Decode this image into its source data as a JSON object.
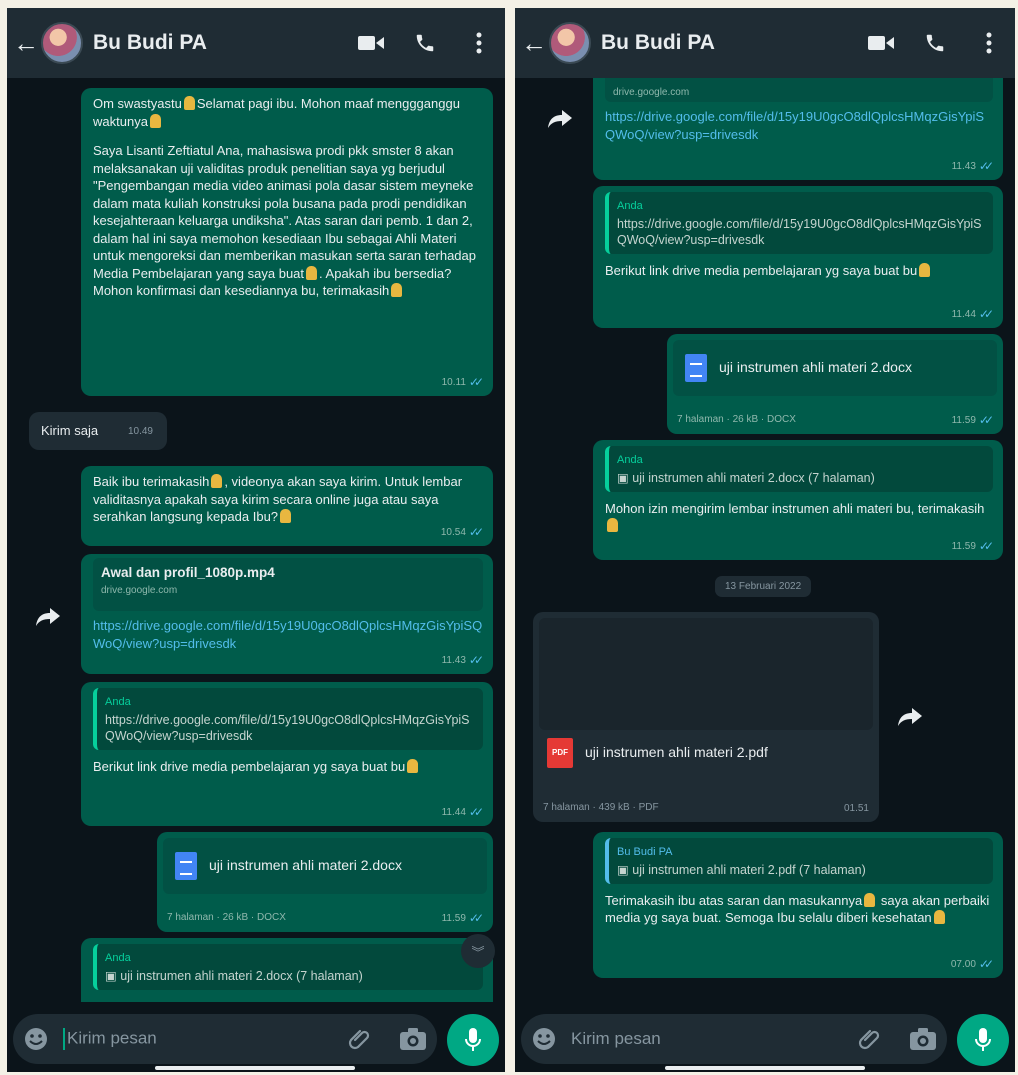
{
  "chat": {
    "contact_name": "Bu Budi PA",
    "input_placeholder": "Kirim pesan"
  },
  "left": {
    "m1": {
      "line1": "Om swastyastu",
      "line1b": "Selamat pagi ibu. Mohon maaf menggganggu waktunya",
      "body": "Saya Lisanti Zeftiatul Ana, mahasiswa prodi pkk smster 8 akan melaksanakan uji validitas produk penelitian saya yg berjudul \"Pengembangan media video animasi pola dasar sistem meyneke dalam mata kuliah konstruksi pola busana pada prodi pendidikan kesejahteraan keluarga undiksha\". Atas saran dari pemb. 1 dan 2, dalam hal ini saya memohon kesediaan Ibu sebagai Ahli Materi untuk mengoreksi dan memberikan masukan serta saran terhadap Media Pembelajaran yang saya buat",
      "body2": ". Apakah ibu bersedia?",
      "body3": "Mohon konfirmasi dan kesediannya bu, terimakasih",
      "time": "10.11"
    },
    "m2": {
      "text": "Kirim saja",
      "time": "10.49"
    },
    "m3": {
      "text": "Baik ibu terimakasih",
      "text2": ", videonya akan saya kirim. Untuk lembar validitasnya apakah saya kirim secara online juga atau saya serahkan langsung kepada Ibu?",
      "time": "10.54"
    },
    "m4": {
      "title": "Awal dan profil_1080p.mp4",
      "domain": "drive.google.com",
      "url": "https://drive.google.com/file/d/15y19U0gcO8dlQplcsHMqzGisYpiSQWoQ/view?usp=drivesdk",
      "time": "11.43"
    },
    "m5": {
      "quote_name": "Anda",
      "quote_text": "https://drive.google.com/file/d/15y19U0gcO8dlQplcsHMqzGisYpiSQWoQ/view?usp=drivesdk",
      "text": "Berikut link drive media pembelajaran yg saya buat bu",
      "time": "11.44"
    },
    "m6": {
      "file": "uji instrumen ahli materi 2.docx",
      "meta": "7 halaman · 26 kB · DOCX",
      "time": "11.59"
    },
    "m7": {
      "quote_name": "Anda",
      "quote_text": "uji instrumen ahli materi 2.docx (7 halaman)"
    }
  },
  "right": {
    "m0": {
      "domain": "drive.google.com",
      "url": "https://drive.google.com/file/d/15y19U0gcO8dlQplcsHMqzGisYpiSQWoQ/view?usp=drivesdk",
      "time": "11.43"
    },
    "m1": {
      "quote_name": "Anda",
      "quote_text": "https://drive.google.com/file/d/15y19U0gcO8dlQplcsHMqzGisYpiSQWoQ/view?usp=drivesdk",
      "text": "Berikut link drive media pembelajaran yg saya buat bu",
      "time": "11.44"
    },
    "m2": {
      "file": "uji instrumen ahli materi 2.docx",
      "meta": "7 halaman · 26 kB · DOCX",
      "time": "11.59"
    },
    "m3": {
      "quote_name": "Anda",
      "quote_text": "uji instrumen ahli materi 2.docx (7 halaman)",
      "text": "Mohon izin mengirim lembar instrumen ahli materi bu, terimakasih",
      "time": "11.59"
    },
    "date_chip": "13 Februari 2022",
    "m4": {
      "file": "uji instrumen ahli materi 2.pdf",
      "pdf_label": "PDF",
      "meta": "7 halaman · 439 kB · PDF",
      "time": "01.51"
    },
    "m5": {
      "quote_name": "Bu Budi PA",
      "quote_text": "uji instrumen ahli materi 2.pdf (7 halaman)",
      "text": "Terimakasih ibu atas saran dan masukannya",
      "text2": "saya akan perbaiki media yg saya buat. Semoga Ibu selalu diberi kesehatan",
      "time": "07.00"
    }
  },
  "icons": {
    "back": "arrow-left-icon",
    "video": "video-camera-icon",
    "call": "phone-icon",
    "menu": "more-vertical-icon",
    "emoji": "emoji-icon",
    "attach": "paperclip-icon",
    "camera": "camera-icon",
    "mic": "microphone-icon",
    "forward": "forward-icon",
    "scroll": "chevron-double-down-icon"
  },
  "colors": {
    "header": "#1f2c34",
    "background": "#0b141a",
    "outgoing": "#005c4b",
    "incoming": "#1f2c34",
    "accent": "#00a884",
    "read_ticks": "#53bdeb"
  }
}
